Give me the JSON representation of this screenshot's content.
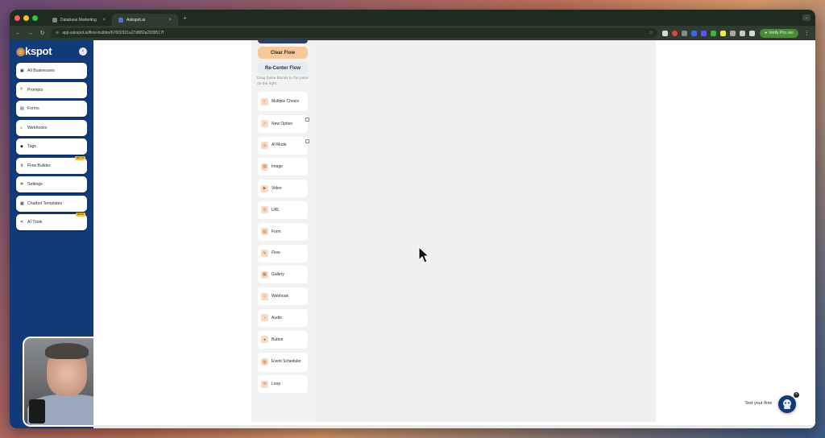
{
  "browser": {
    "tabs": [
      {
        "label": "Database Marketing"
      },
      {
        "label": "Askspot.ai"
      }
    ],
    "url": "app.askspot.ai/flow-builder/67602931a27d882a2839517f",
    "verify_label": "Verify Pro sec",
    "new_tab_symbol": "+",
    "colors": {
      "frame": "#1f2a21",
      "toolbar": "#2f3d31"
    }
  },
  "sidebar": {
    "brand_prefix": "a",
    "brand_rest": "kspot",
    "collapse_symbol": "‹",
    "items": [
      {
        "label": "All Businesses",
        "icon": "briefcase-icon"
      },
      {
        "label": "Prompts",
        "icon": "question-icon"
      },
      {
        "label": "Forms",
        "icon": "form-icon"
      },
      {
        "label": "Webhooks",
        "icon": "webhook-icon"
      },
      {
        "label": "Tags",
        "icon": "tag-icon"
      },
      {
        "label": "Flow Builder",
        "icon": "flow-icon",
        "badge": "BETA"
      },
      {
        "label": "Settings",
        "icon": "gear-icon"
      },
      {
        "label": "Chatbot Templates",
        "icon": "template-icon"
      },
      {
        "label": "AI Tools",
        "icon": "ai-tools-icon",
        "badge": "NEW"
      }
    ],
    "colors": {
      "bg": "#123a78",
      "accent": "#f2a44a"
    }
  },
  "palette": {
    "clear_label": "Clear Flow",
    "recenter_label": "Re-Center Flow",
    "hint": "Drag these blocks to the pane on the right.",
    "blocks": [
      {
        "label": "Multiple Choice",
        "icon": "multiple-choice-icon"
      },
      {
        "label": "New Option",
        "icon": "check-icon"
      },
      {
        "label": "AI Mode",
        "icon": "ai-mode-icon"
      },
      {
        "label": "Image",
        "icon": "image-icon"
      },
      {
        "label": "Video",
        "icon": "video-icon"
      },
      {
        "label": "URL",
        "icon": "link-icon"
      },
      {
        "label": "Form",
        "icon": "form-icon"
      },
      {
        "label": "Flow",
        "icon": "flow-icon"
      },
      {
        "label": "Gallery",
        "icon": "gallery-icon"
      },
      {
        "label": "Webhook",
        "icon": "webhook-icon"
      },
      {
        "label": "Audio",
        "icon": "audio-icon"
      },
      {
        "label": "Button",
        "icon": "button-icon"
      },
      {
        "label": "Event Scheduler",
        "icon": "calendar-icon"
      },
      {
        "label": "Loop",
        "icon": "loop-icon"
      }
    ]
  },
  "canvas": {
    "test_label": "Test your flow",
    "close_symbol": "×"
  }
}
